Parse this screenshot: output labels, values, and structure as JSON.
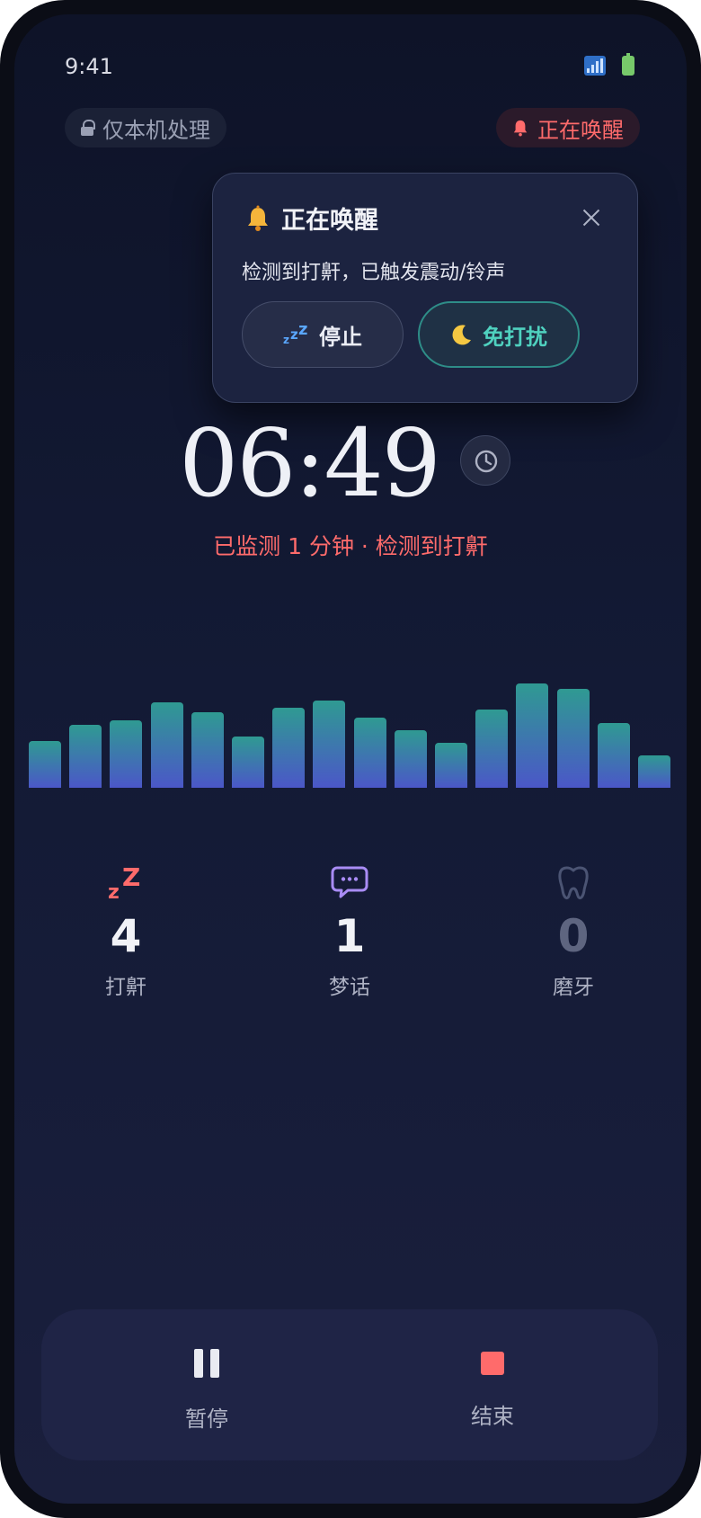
{
  "status_bar": {
    "time": "9:41"
  },
  "header": {
    "privacy_label": "仅本机处理",
    "waking_label": "正在唤醒"
  },
  "popup": {
    "title": "正在唤醒",
    "message": "检测到打鼾，已触发震动/铃声",
    "stop_label": "停止",
    "dnd_label": "免打扰"
  },
  "clock": {
    "time": "06:49"
  },
  "monitor": {
    "status": "已监测 1 分钟 · 检测到打鼾"
  },
  "levels": {
    "values": [
      0.45,
      0.6,
      0.65,
      0.82,
      0.72,
      0.49,
      0.77,
      0.84,
      0.67,
      0.55,
      0.43,
      0.75,
      1.0,
      0.95,
      0.62,
      0.31
    ]
  },
  "stats": {
    "snore": {
      "count": "4",
      "label": "打鼾",
      "icon": "snore-zz-icon"
    },
    "sleeptalk": {
      "count": "1",
      "label": "梦话",
      "icon": "speech-bubble-icon"
    },
    "grinding": {
      "count": "0",
      "label": "磨牙",
      "icon": "tooth-icon"
    }
  },
  "controls": {
    "pause_label": "暂停",
    "end_label": "结束"
  },
  "colors": {
    "accent_red": "#ff6b6b",
    "accent_teal": "#4fd1bf",
    "accent_purple": "#a98cf5"
  }
}
